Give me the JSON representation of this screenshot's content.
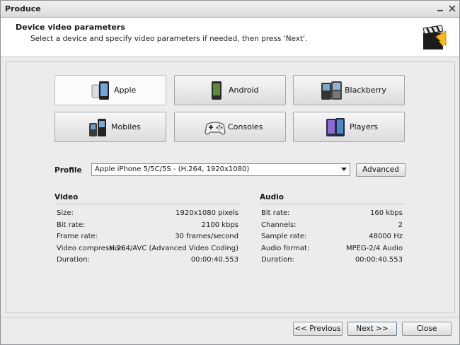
{
  "window": {
    "title": "Produce"
  },
  "header": {
    "title": "Device video parameters",
    "subtitle": "Select a device and specify video parameters if needed, then press 'Next'."
  },
  "devices": [
    {
      "label": "Apple",
      "icon": "iphone-icon",
      "selected": true
    },
    {
      "label": "Android",
      "icon": "android-phone-icon",
      "selected": false
    },
    {
      "label": "Blackberry",
      "icon": "blackberry-icon",
      "selected": false
    },
    {
      "label": "Mobiles",
      "icon": "mobile-phones-icon",
      "selected": false
    },
    {
      "label": "Consoles",
      "icon": "gamepad-icon",
      "selected": false
    },
    {
      "label": "Players",
      "icon": "media-player-icon",
      "selected": false
    }
  ],
  "profile": {
    "label": "Profile",
    "value": "Apple iPhone 5/5C/5S - (H.264, 1920x1080)",
    "advanced_label": "Advanced"
  },
  "video": {
    "title": "Video",
    "rows": [
      {
        "key": "Size:",
        "value": "1920x1080 pixels"
      },
      {
        "key": "Bit rate:",
        "value": "2100 kbps"
      },
      {
        "key": "Frame rate:",
        "value": "30 frames/second"
      },
      {
        "key": "Video compression:",
        "value": "H.264/AVC (Advanced Video Coding)"
      },
      {
        "key": "Duration:",
        "value": "00:00:40.553"
      }
    ]
  },
  "audio": {
    "title": "Audio",
    "rows": [
      {
        "key": "Bit rate:",
        "value": "160 kbps"
      },
      {
        "key": "Channels:",
        "value": "2"
      },
      {
        "key": "Sample rate:",
        "value": "48000 Hz"
      },
      {
        "key": "Audio format:",
        "value": "MPEG-2/4 Audio"
      },
      {
        "key": "Duration:",
        "value": "00:00:40.553"
      }
    ]
  },
  "footer": {
    "previous_label": "<< Previous",
    "next_label": "Next >>",
    "close_label": "Close"
  }
}
